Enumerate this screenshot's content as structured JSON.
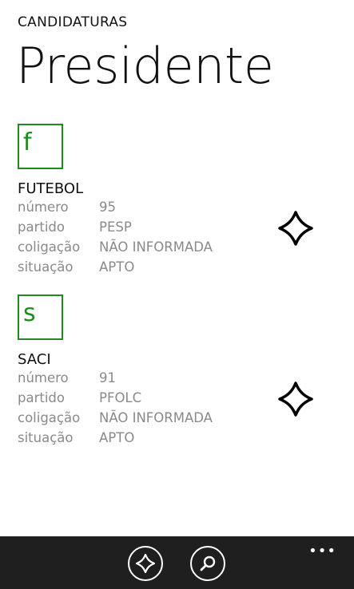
{
  "header": {
    "app_title": "CANDIDATURAS",
    "page_title": "Presidente"
  },
  "labels": {
    "numero": "número",
    "partido": "partido",
    "coligacao": "coligação",
    "situacao": "situação"
  },
  "candidates": [
    {
      "initial": "f",
      "name": "FUTEBOL",
      "numero": "95",
      "partido": "PESP",
      "coligacao": "NÃO INFORMADA",
      "situacao": "APTO",
      "favorite_icon": "diamond-outline-icon"
    },
    {
      "initial": "s",
      "name": "SACI",
      "numero": "91",
      "partido": "PFOLC",
      "coligacao": "NÃO INFORMADA",
      "situacao": "APTO",
      "favorite_icon": "diamond-outline-icon"
    }
  ],
  "appbar": {
    "buttons": [
      {
        "icon": "diamond-icon"
      },
      {
        "icon": "search-icon"
      }
    ],
    "more": "•••"
  },
  "colors": {
    "accent": "#1f8b1f",
    "appbar_bg": "#1f1f1f",
    "secondary_text": "#8a8a8a"
  }
}
